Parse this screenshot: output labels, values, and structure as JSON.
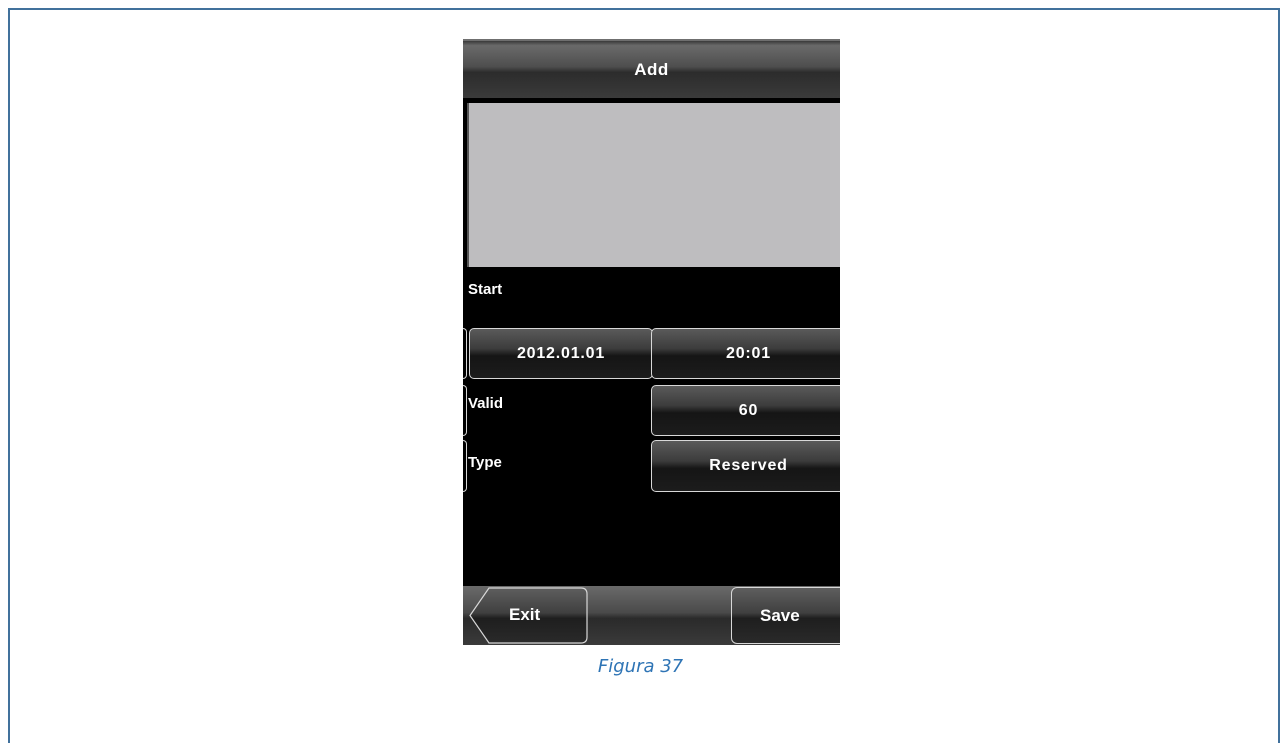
{
  "screen": {
    "title": "Add",
    "start_label": "Start",
    "start_date": "2012.01.01",
    "start_time": "20:01",
    "valid_label": "Valid",
    "valid_value": "60",
    "type_label": "Type",
    "type_value": "Reserved"
  },
  "footer": {
    "exit_label": "Exit",
    "save_label": "Save"
  },
  "caption": "Figura 37",
  "colors": {
    "frame_border": "#41719c",
    "caption": "#2e74b5",
    "preview_area": "#bebdbf",
    "screen_bg": "#000000"
  },
  "icons": {
    "exit": "arrow-left-icon"
  }
}
